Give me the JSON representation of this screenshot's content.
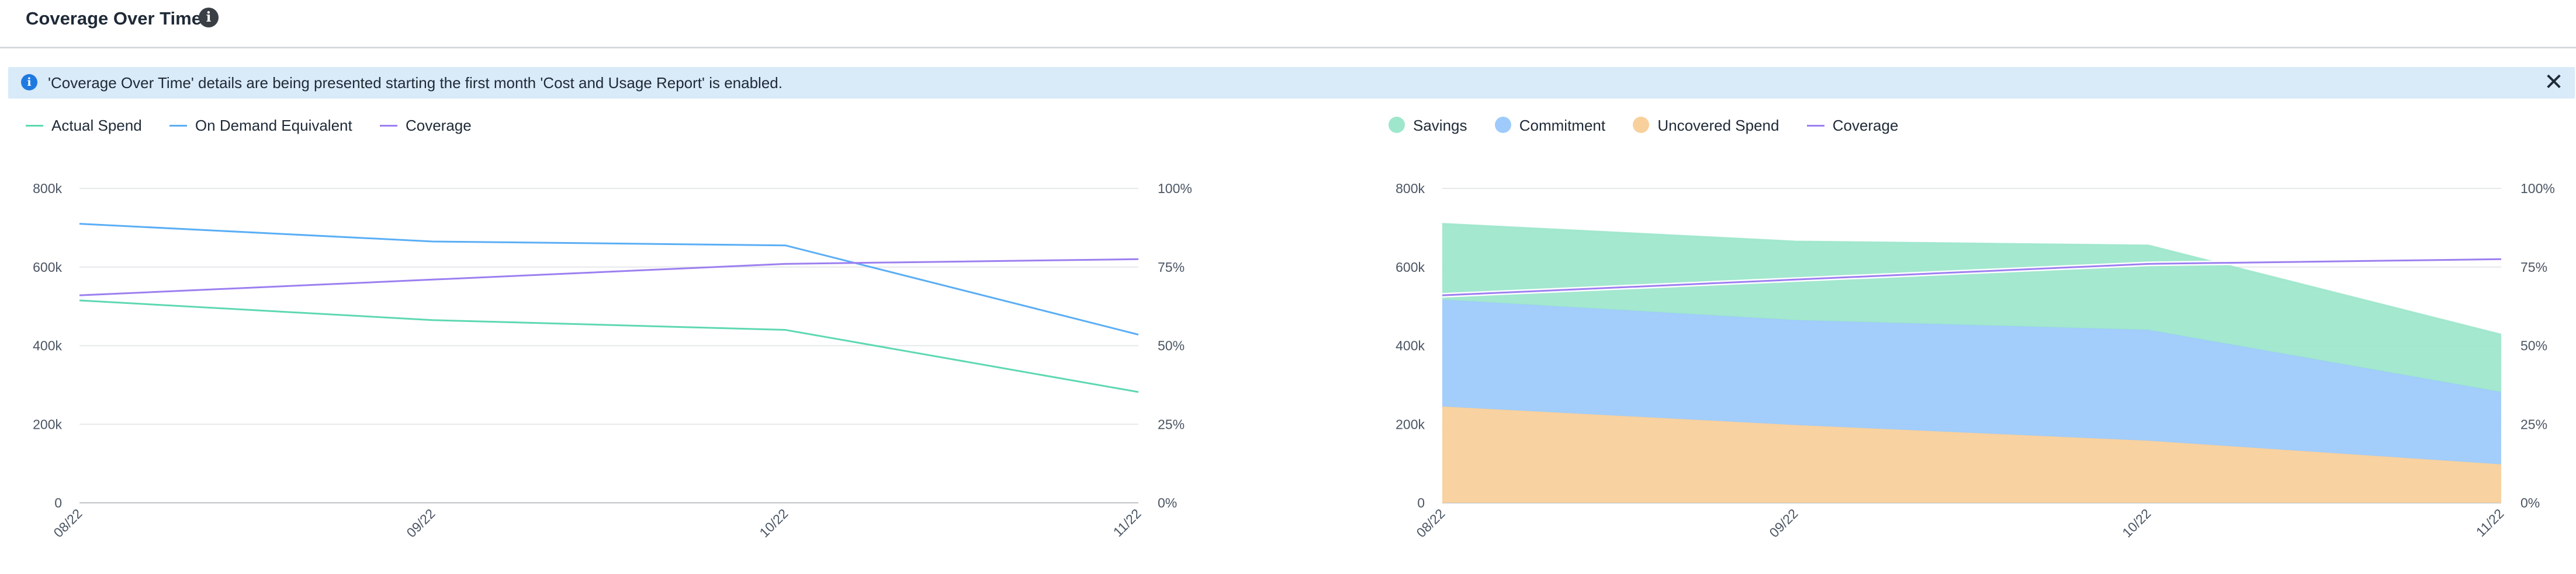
{
  "header": {
    "title": "Coverage Over Time",
    "info_icon": "info-circle-icon"
  },
  "banner": {
    "icon": "info-icon",
    "text": "'Coverage Over Time' details are being presented starting the first month 'Cost and Usage Report' is enabled.",
    "close_icon": "close-icon",
    "color": "#d9eaf8"
  },
  "colors": {
    "actual_spend": "#5ed8b2",
    "on_demand": "#5aaef5",
    "coverage": "#9c7ff0",
    "savings": "#9ee7cc",
    "commitment": "#9ecbfb",
    "uncovered": "#f8d09c"
  },
  "chart_data": [
    {
      "type": "line",
      "x": [
        "08/22",
        "09/22",
        "10/22",
        "11/22"
      ],
      "y_left_ticks": [
        "0",
        "200k",
        "400k",
        "600k",
        "800k"
      ],
      "y_right_ticks": [
        "0%",
        "25%",
        "50%",
        "75%",
        "100%"
      ],
      "ylim": [
        0,
        800000
      ],
      "ylim_right": [
        0,
        100
      ],
      "grid": true,
      "legend_position": "top-left",
      "series": [
        {
          "name": "Actual Spend",
          "axis": "left",
          "color": "#5ed8b2",
          "values": [
            515000,
            465000,
            440000,
            282000
          ]
        },
        {
          "name": "On Demand Equivalent",
          "axis": "left",
          "color": "#5aaef5",
          "values": [
            710000,
            665000,
            655000,
            428000
          ]
        },
        {
          "name": "Coverage",
          "axis": "right",
          "color": "#9c7ff0",
          "values": [
            66,
            71,
            76,
            77.5
          ]
        }
      ]
    },
    {
      "type": "area",
      "stacked": true,
      "x": [
        "08/22",
        "09/22",
        "10/22",
        "11/22"
      ],
      "y_left_ticks": [
        "0",
        "200k",
        "400k",
        "600k",
        "800k"
      ],
      "y_right_ticks": [
        "0%",
        "25%",
        "50%",
        "75%",
        "100%"
      ],
      "ylim": [
        0,
        800000
      ],
      "ylim_right": [
        0,
        100
      ],
      "grid": true,
      "legend_position": "top-left",
      "series": [
        {
          "name": "Uncovered Spend",
          "axis": "left",
          "color": "#f8d09c",
          "values": [
            245000,
            198000,
            158000,
            98000
          ]
        },
        {
          "name": "Commitment",
          "axis": "left",
          "color": "#9ecbfb",
          "values": [
            272000,
            267000,
            282000,
            184000
          ]
        },
        {
          "name": "Savings",
          "axis": "left",
          "color": "#9ee7cc",
          "values": [
            193000,
            200000,
            215000,
            146000
          ]
        },
        {
          "name": "Coverage",
          "axis": "right",
          "color": "#9c7ff0",
          "values": [
            66,
            71,
            76,
            77.5
          ]
        }
      ],
      "legend_order": [
        "Savings",
        "Commitment",
        "Uncovered Spend",
        "Coverage"
      ]
    }
  ]
}
